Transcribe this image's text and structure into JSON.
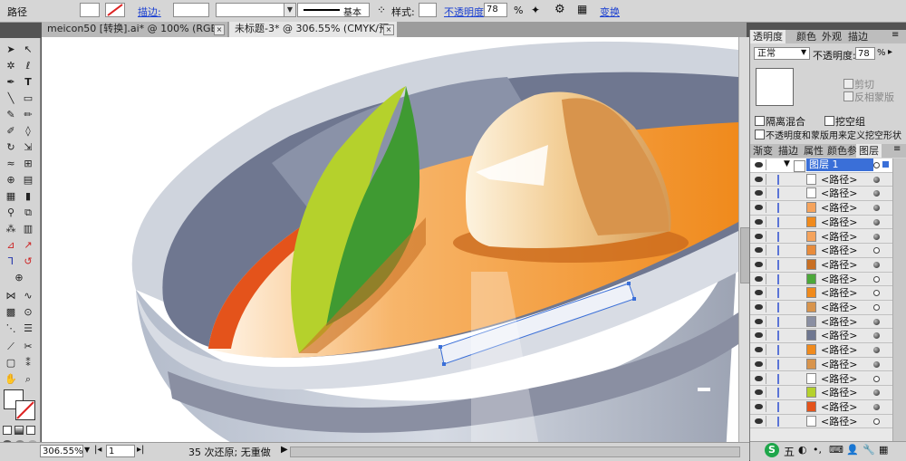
{
  "control_bar": {
    "object_type": "路径",
    "stroke_link": "描边:",
    "stroke_profile": "基本",
    "style_label": "样式:",
    "opacity_link": "不透明度",
    "opacity_value": "78",
    "opacity_unit": "%",
    "transform_link": "变换"
  },
  "doc_tabs": [
    {
      "label": "meicon50 [转换].ai* @ 100% (RGB/预览)",
      "close": "×"
    },
    {
      "label": "未标题-3* @ 306.55% (CMYK/预览)",
      "close": "×"
    }
  ],
  "transparency_panel": {
    "tabs": [
      "透明度",
      "颜色",
      "外观",
      "描边"
    ],
    "blend_mode": "正常",
    "opacity_label": "不透明度:",
    "opacity_value": "78",
    "opacity_unit": "%",
    "clip_label": "剪切",
    "invert_mask_label": "反相蒙版",
    "isolate_blending": "隔离混合",
    "knockout_group": "挖空组",
    "opacity_mask_knockout": "不透明度和蒙版用来定义挖空形状"
  },
  "layers_panel": {
    "tabs": [
      "渐变",
      "描边",
      "属性",
      "颜色参",
      "图层"
    ],
    "layer_name": "图层 1",
    "sublayers": [
      "<路径>",
      "<路径>",
      "<路径>",
      "<路径>",
      "<路径>",
      "<路径>",
      "<路径>",
      "<路径>",
      "<路径>",
      "<路径>",
      "<路径>",
      "<路径>",
      "<路径>",
      "<路径>",
      "<路径>",
      "<路径>",
      "<路径>",
      "<路径>"
    ],
    "target_filled": [
      true,
      true,
      true,
      true,
      true,
      false,
      true,
      false,
      false,
      false,
      true,
      true,
      true,
      true,
      false,
      true,
      true,
      false
    ]
  },
  "status_bar": {
    "zoom": "306.55%",
    "page": "1",
    "undo_info": "35 次还原; 无重做"
  },
  "ime": {
    "label": "五"
  },
  "colors": {
    "accent_blue": "#3a6fd8",
    "orange": "#f08a1c",
    "leaf_green": "#4ca83a",
    "bowl_gray": "#8c93a6"
  }
}
